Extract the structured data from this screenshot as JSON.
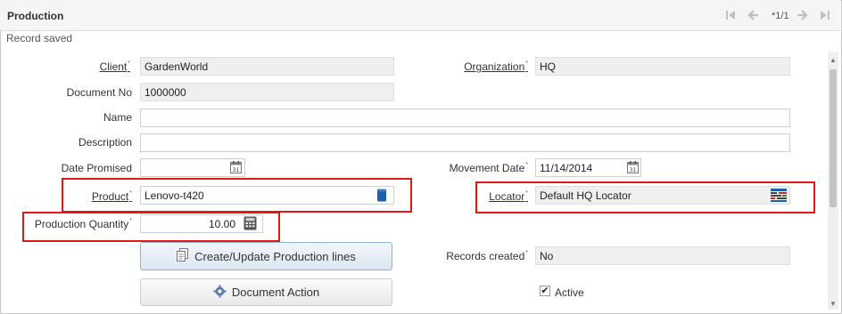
{
  "window": {
    "title": "Production"
  },
  "nav": {
    "counter": "*1/1",
    "first_icon": "first-record-icon",
    "prev_icon": "previous-record-icon",
    "next_icon": "next-record-icon",
    "last_icon": "last-record-icon"
  },
  "status": {
    "message": "Record saved"
  },
  "fields": {
    "client": {
      "label": "Client",
      "value": "GardenWorld",
      "required": "*"
    },
    "organization": {
      "label": "Organization",
      "value": "HQ",
      "required": "*"
    },
    "document_no": {
      "label": "Document No",
      "value": "1000000"
    },
    "name": {
      "label": "Name",
      "value": ""
    },
    "description": {
      "label": "Description",
      "value": ""
    },
    "date_promised": {
      "label": "Date Promised",
      "value": ""
    },
    "movement_date": {
      "label": "Movement Date",
      "value": "11/14/2014",
      "required": "*"
    },
    "product": {
      "label": "Product",
      "value": "Lenovo-t420",
      "required": "*"
    },
    "locator": {
      "label": "Locator",
      "value": "Default HQ Locator",
      "required": "*"
    },
    "production_quantity": {
      "label": "Production Quantity",
      "value": "10.00",
      "required": "*"
    },
    "records_created": {
      "label": "Records created",
      "value": "No",
      "required": "*"
    },
    "active": {
      "label": "Active",
      "checked": true
    }
  },
  "buttons": {
    "create_update": "Create/Update Production lines",
    "document_action": "Document Action"
  },
  "colors": {
    "highlight": "#e21818",
    "accent_blue": "#1f5fa8"
  }
}
